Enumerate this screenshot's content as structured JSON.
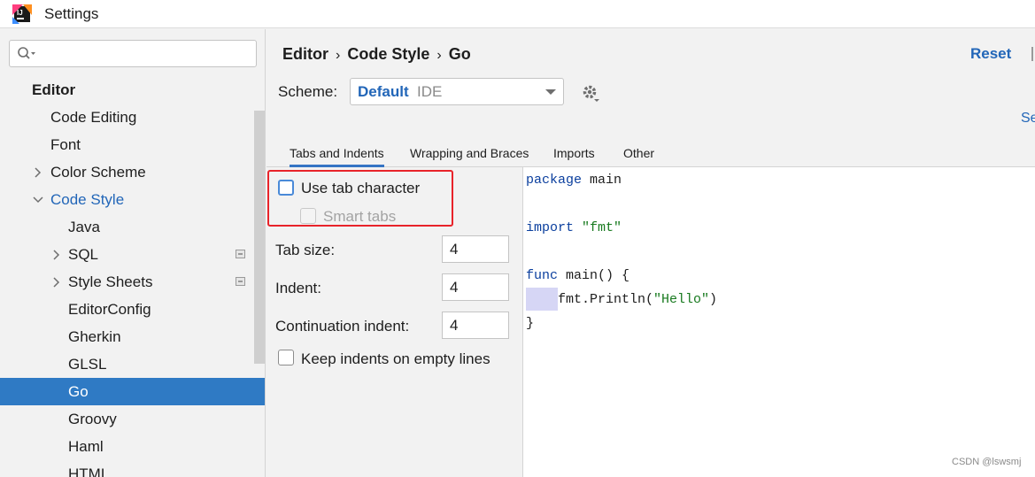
{
  "window": {
    "title": "Settings"
  },
  "sidebar": {
    "search_placeholder": "",
    "items": [
      {
        "label": "Editor",
        "level": 0
      },
      {
        "label": "Code Editing",
        "level": 1
      },
      {
        "label": "Font",
        "level": 1
      },
      {
        "label": "Color Scheme",
        "level": 1,
        "expandable": true
      },
      {
        "label": "Code Style",
        "level": 1,
        "expanded": true
      },
      {
        "label": "Java",
        "level": 2
      },
      {
        "label": "SQL",
        "level": 2,
        "expandable": true
      },
      {
        "label": "Style Sheets",
        "level": 2,
        "expandable": true
      },
      {
        "label": "EditorConfig",
        "level": 2
      },
      {
        "label": "Gherkin",
        "level": 2
      },
      {
        "label": "GLSL",
        "level": 2
      },
      {
        "label": "Go",
        "level": 2,
        "selected": true
      },
      {
        "label": "Groovy",
        "level": 2
      },
      {
        "label": "Haml",
        "level": 2
      },
      {
        "label": "HTML",
        "level": 2
      }
    ]
  },
  "header": {
    "breadcrumb": [
      "Editor",
      "Code Style",
      "Go"
    ],
    "reset_label": "Reset",
    "set_from_label": "Se"
  },
  "scheme": {
    "label": "Scheme:",
    "name": "Default",
    "kind": "IDE"
  },
  "tabs": [
    "Tabs and Indents",
    "Wrapping and Braces",
    "Imports",
    "Other"
  ],
  "options": {
    "use_tab_character": "Use tab character",
    "smart_tabs": "Smart tabs",
    "tab_size_label": "Tab size:",
    "tab_size": "4",
    "indent_label": "Indent:",
    "indent": "4",
    "continuation_label": "Continuation indent:",
    "continuation": "4",
    "keep_indents": "Keep indents on empty lines"
  },
  "preview": {
    "line1_kw": "package",
    "line1_rest": " main",
    "line2_kw": "import",
    "line2_str": "\"fmt\"",
    "line3_kw": "func",
    "line3_rest": " main() {",
    "line4_pre": "fmt.Println(",
    "line4_str": "\"Hello\"",
    "line4_post": ")",
    "line5": "}"
  },
  "watermark": "CSDN @lswsmj",
  "colors": {
    "accent": "#2f7ac4",
    "link": "#2266b8",
    "highlight": "#e8232a"
  }
}
